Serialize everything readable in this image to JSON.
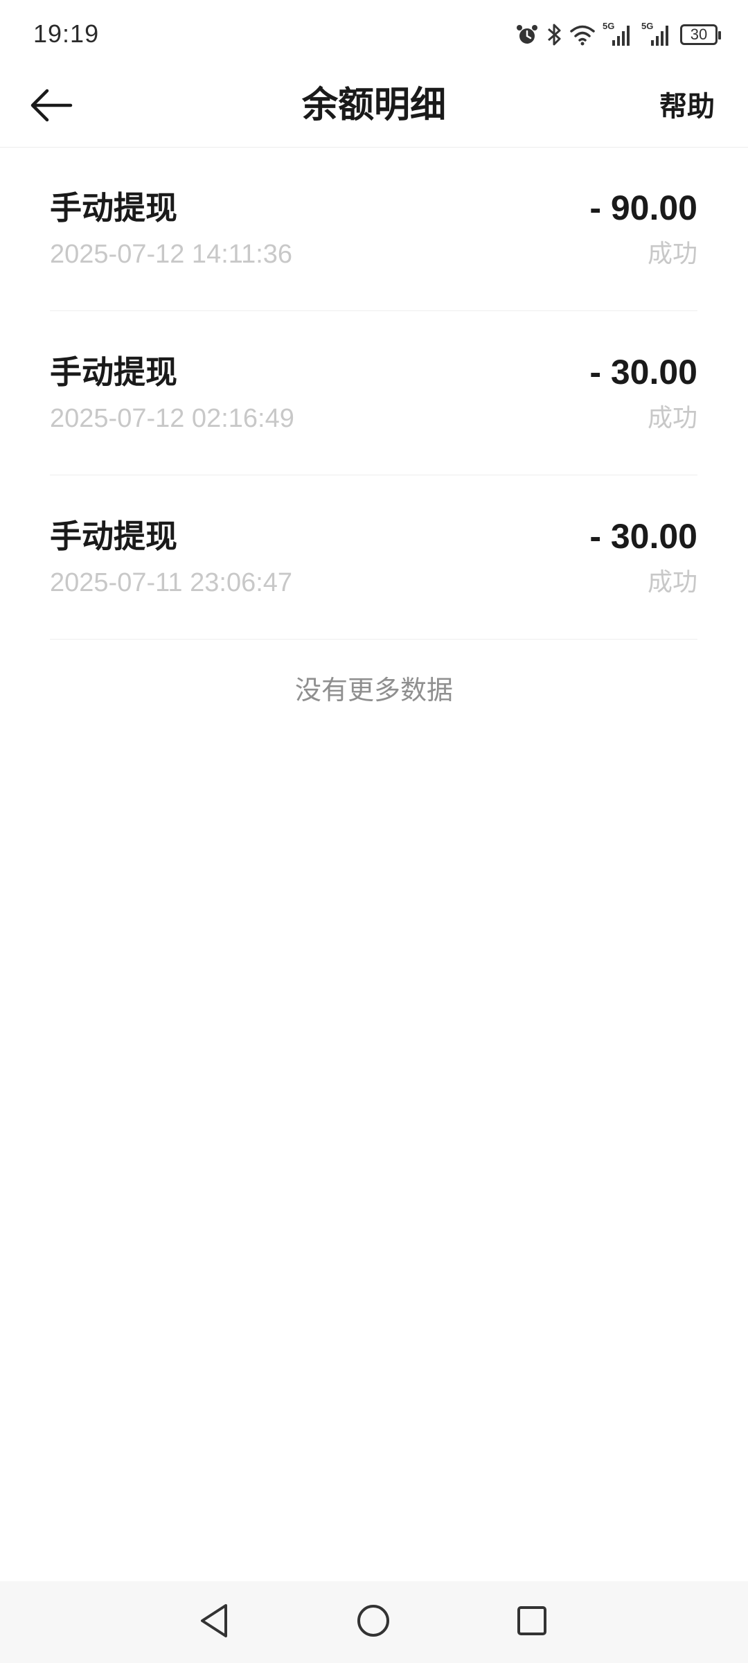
{
  "status_bar": {
    "time": "19:19",
    "icons": [
      "alarm-icon",
      "bluetooth-icon",
      "wifi-icon",
      "signal-5g-icon",
      "signal-5g-icon"
    ],
    "network_label_1": "5G",
    "network_label_2": "5G",
    "battery": "30"
  },
  "header": {
    "back_icon": "arrow-left-icon",
    "title": "余额明细",
    "help_label": "帮助"
  },
  "transactions": [
    {
      "title": "手动提现",
      "time": "2025-07-12 14:11:36",
      "amount": "- 90.00",
      "status": "成功"
    },
    {
      "title": "手动提现",
      "time": "2025-07-12 02:16:49",
      "amount": "- 30.00",
      "status": "成功"
    },
    {
      "title": "手动提现",
      "time": "2025-07-11 23:06:47",
      "amount": "- 30.00",
      "status": "成功"
    }
  ],
  "list_footer": "没有更多数据",
  "nav_bar": {
    "icons": [
      "triangle-back-icon",
      "circle-home-icon",
      "square-recent-icon"
    ]
  },
  "colors": {
    "primary_text": "#1a1a1a",
    "secondary_text": "#c8c8c8",
    "footer_text": "#8f8f8f",
    "background": "#ffffff",
    "nav_background": "#f7f7f7"
  }
}
